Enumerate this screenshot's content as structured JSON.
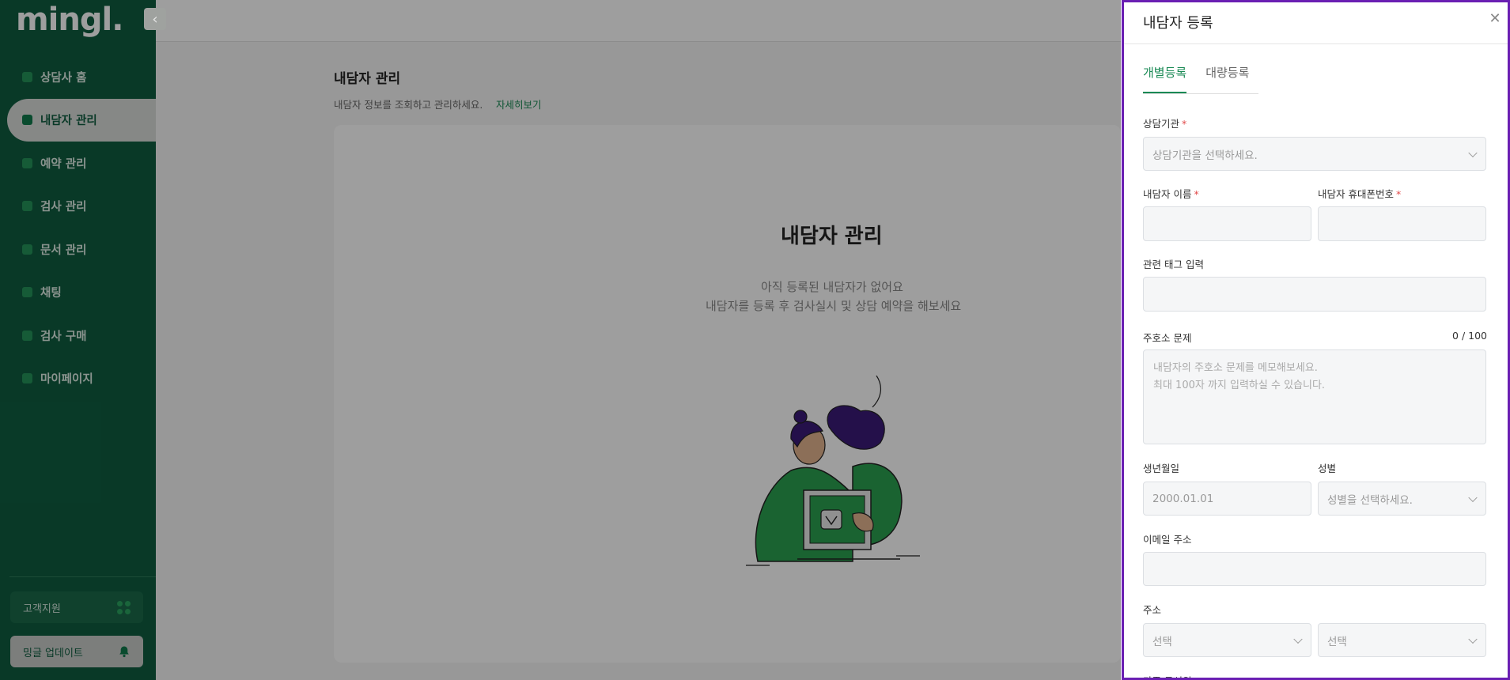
{
  "sidebar": {
    "logo": "mingl.",
    "collapse_icon": "chevron-left-icon",
    "items": [
      {
        "label": "상담사 홈",
        "icon": "home-icon"
      },
      {
        "label": "내담자 관리",
        "icon": "client-icon",
        "active": true
      },
      {
        "label": "예약 관리",
        "icon": "calendar-icon"
      },
      {
        "label": "검사 관리",
        "icon": "test-icon"
      },
      {
        "label": "문서 관리",
        "icon": "document-icon"
      },
      {
        "label": "채팅",
        "icon": "chat-icon"
      },
      {
        "label": "검사 구매",
        "icon": "cart-icon"
      },
      {
        "label": "마이페이지",
        "icon": "user-icon"
      }
    ],
    "support_label": "고객지원",
    "update_label": "밍글 업데이트"
  },
  "main": {
    "title": "내담자 관리",
    "subtitle": "내담자 정보를 조회하고 관리하세요.",
    "subtitle_link": "자세히보기",
    "empty_title": "내담자 관리",
    "empty_line1": "아직 등록된 내담자가 없어요",
    "empty_line2": "내담자를 등록 후 검사실시 및 상담 예약을 해보세요"
  },
  "drawer": {
    "title": "내담자 등록",
    "tabs": [
      {
        "label": "개별등록",
        "active": true
      },
      {
        "label": "대량등록",
        "active": false
      }
    ],
    "org_label": "상담기관",
    "org_placeholder": "상담기관을 선택하세요.",
    "name_label": "내담자 이름",
    "phone_label": "내담자 휴대폰번호",
    "tag_label": "관련 태그 입력",
    "complaint_label": "주호소 문제",
    "complaint_counter": "0 / 100",
    "complaint_placeholder_1": "내담자의 주호소 문제를 메모해보세요.",
    "complaint_placeholder_2": "최대 100자 까지 입력하실 수 있습니다.",
    "birth_label": "생년월일",
    "birth_placeholder": "2000.01.01",
    "gender_label": "성별",
    "gender_placeholder": "성별을 선택하세요.",
    "email_label": "이메일 주소",
    "address_label": "주소",
    "address_select_1": "선택",
    "address_select_2": "선택",
    "family_label": "가족 구성원",
    "required_mark": "*"
  },
  "colors": {
    "brand": "#0f5d40",
    "accent": "#1a8a55",
    "required": "#e14a4a",
    "drawer_border": "#6a1fb3"
  }
}
